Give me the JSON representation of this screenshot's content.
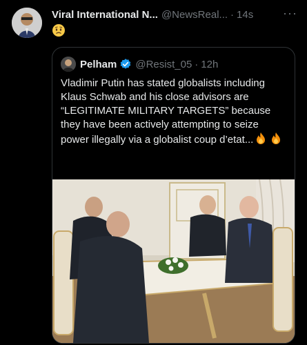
{
  "tweet": {
    "author_name": "Viral International N...",
    "author_handle": "@NewsReal...",
    "separator": "·",
    "time": "14s",
    "more": "···",
    "emoji": "worried-face"
  },
  "quoted_tweet": {
    "author_name": "Pelham",
    "verified": true,
    "author_handle": "@Resist_05",
    "separator": "·",
    "time": "12h",
    "text": "Vladimir Putin has stated globalists including Klaus Schwab and his close advisors are “LEGITIMATE MILITARY TARGETS” because they have been actively attempting to seize power illegally via a globalist coup d’etat...",
    "text_emojis": [
      "fire-emoji",
      "fire-emoji"
    ],
    "image_description": "photo"
  },
  "colors": {
    "background": "#000000",
    "text_primary": "#e7e9ea",
    "text_secondary": "#71767b",
    "border": "#2f3336",
    "verified": "#1d9bf0"
  }
}
